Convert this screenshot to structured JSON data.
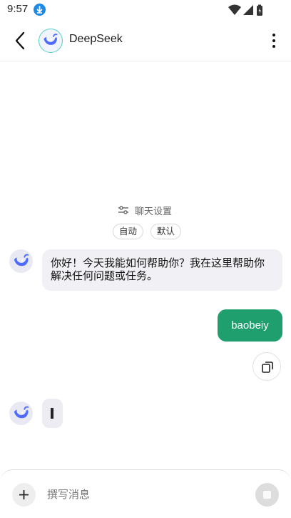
{
  "status_bar": {
    "time": "9:57"
  },
  "header": {
    "title": "DeepSeek"
  },
  "chat_settings": {
    "label": "聊天设置",
    "chips": [
      "自动",
      "默认"
    ]
  },
  "messages": {
    "bot_greeting": "你好！今天我能如何帮助你？我在这里帮助你解决任何问题或任务。",
    "user_message": "baobeiy"
  },
  "composer": {
    "placeholder": "撰写消息"
  },
  "colors": {
    "user_bubble": "#1f9e6e",
    "bot_bubble": "#f0f0f5",
    "accent": "#4d6bfe"
  }
}
